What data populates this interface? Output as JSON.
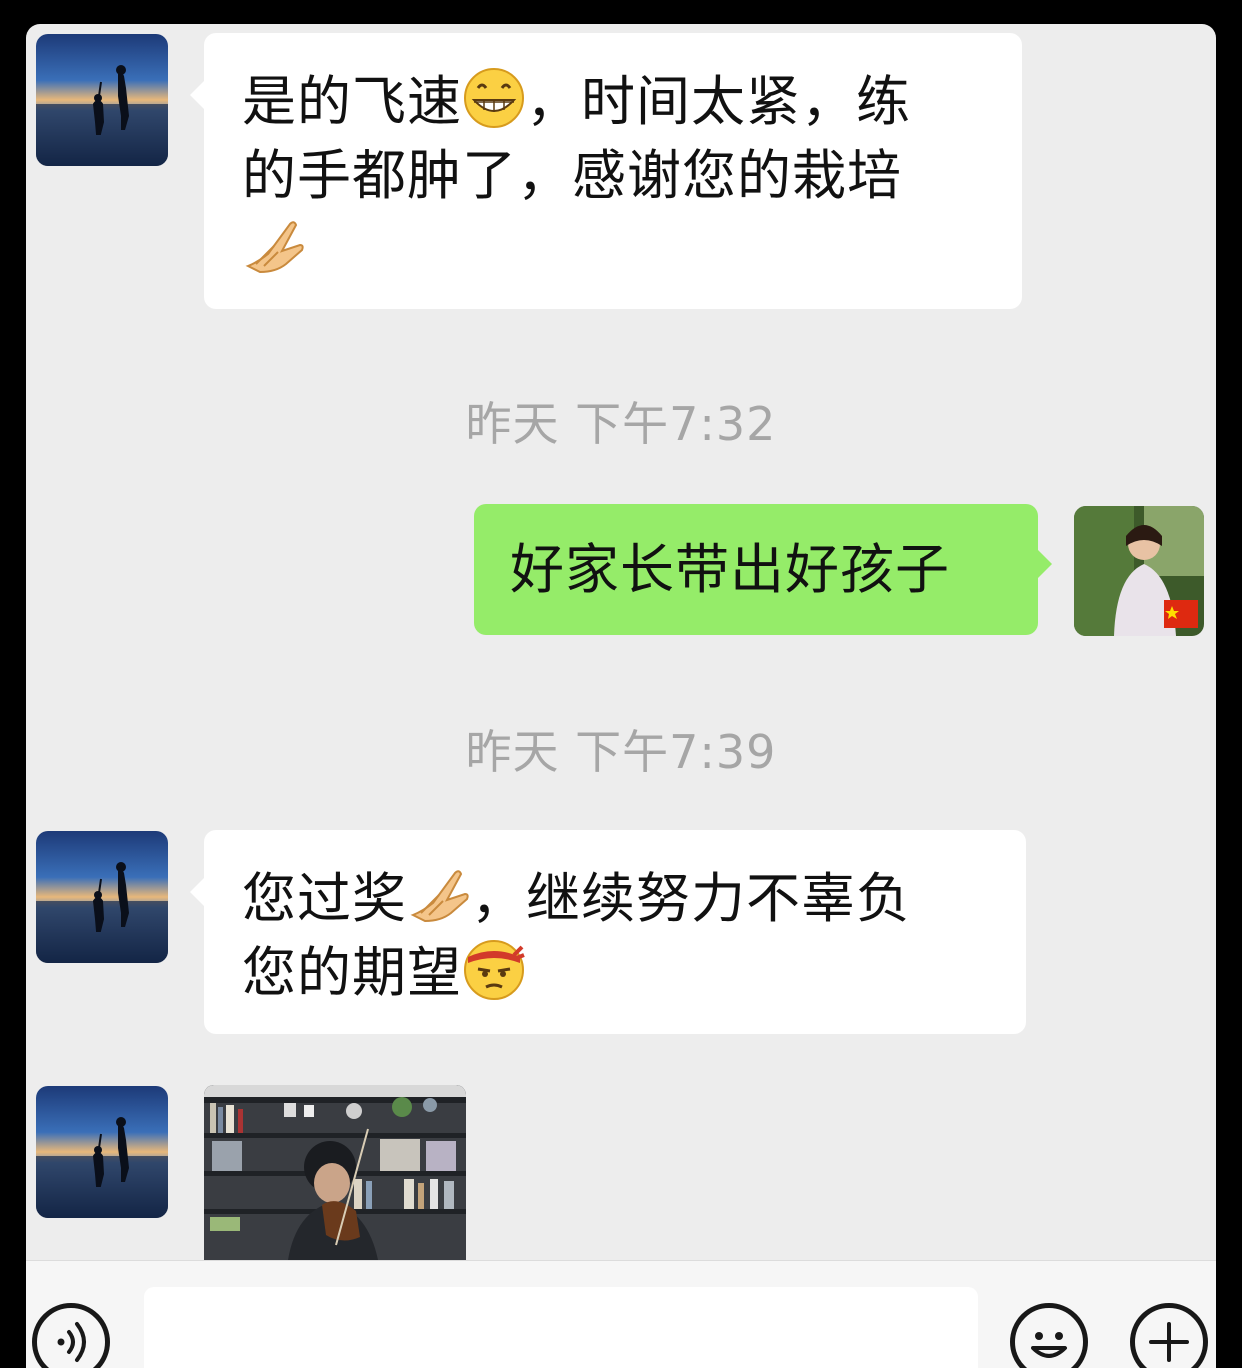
{
  "messages": [
    {
      "side": "left",
      "text_1": "是的飞速",
      "text_2": "，时间太紧，练",
      "text_3": "的手都肿了，感谢您的栽培",
      "emoji_1": "grinning-face-emoji",
      "emoji_2": "praying-hands-emoji"
    },
    {
      "side": "right",
      "text": "好家长带出好孩子"
    },
    {
      "side": "left",
      "text_1": "您过奖",
      "text_2": "，继续努力不辜负",
      "text_3": "您的期望",
      "emoji_1": "praying-hands-emoji",
      "emoji_2": "determined-headband-face-emoji"
    },
    {
      "side": "left",
      "type": "image",
      "image": "photo-boy-playing-violin"
    }
  ],
  "timestamps": [
    "昨天 下午7:32",
    "昨天 下午7:39"
  ],
  "avatars": {
    "contact": "avatar-sunset-beach-silhouettes",
    "self": "avatar-woman-with-flag"
  },
  "input_bar": {
    "placeholder": "",
    "voice_icon": "voice-icon",
    "emoji_icon": "emoji-icon",
    "plus_icon": "plus-icon"
  },
  "colors": {
    "background": "#ededed",
    "incoming_bubble": "#ffffff",
    "outgoing_bubble": "#95ec69",
    "timestamp_text": "#a6a6a6"
  }
}
